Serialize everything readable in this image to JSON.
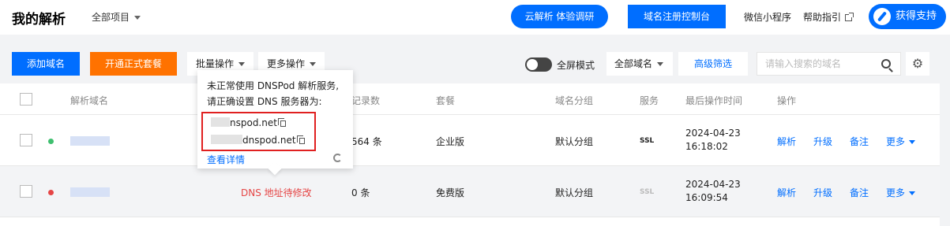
{
  "header": {
    "title": "我的解析",
    "project_select": "全部项目",
    "survey_button": "云解析 体验调研",
    "console_button": "域名注册控制台",
    "wechat_link": "微信小程序",
    "help_link": "帮助指引",
    "support_button": "获得支持"
  },
  "toolbar": {
    "add_domain": "添加域名",
    "upgrade_plan": "开通正式套餐",
    "batch_ops": "批量操作",
    "more_ops": "更多操作",
    "fullscreen_label": "全屏模式",
    "domain_filter": "全部域名",
    "advanced_filter": "高级筛选",
    "search_placeholder": "请输入搜索的域名"
  },
  "table": {
    "headers": {
      "domain": "解析域名",
      "records": "记录数",
      "plan": "套餐",
      "group": "域名分组",
      "service": "服务",
      "last_op": "最后操作时间",
      "actions": "操作"
    },
    "rows": [
      {
        "status_color": "#3fbf6f",
        "records": "564 条",
        "plan": "企业版",
        "group": "默认分组",
        "service": "SSL",
        "date": "2024-04-23",
        "time": "16:18:02",
        "resolve": "解析",
        "upgrade": "升级",
        "note": "备注",
        "more": "更多"
      },
      {
        "status_color": "#e54545",
        "status_text": "DNS 地址待修改",
        "records": "0 条",
        "plan": "免费版",
        "group": "默认分组",
        "service": "SSL",
        "date": "2024-04-23",
        "time": "16:09:54",
        "resolve": "解析",
        "upgrade": "升级",
        "note": "备注",
        "more": "更多"
      }
    ]
  },
  "popover": {
    "line1": "未正常使用 DNSPod 解析服务,",
    "line2": "请正确设置 DNS 服务器为:",
    "ns1": "nspod.net",
    "ns2": "dnspod.net",
    "details_link": "查看详情"
  }
}
